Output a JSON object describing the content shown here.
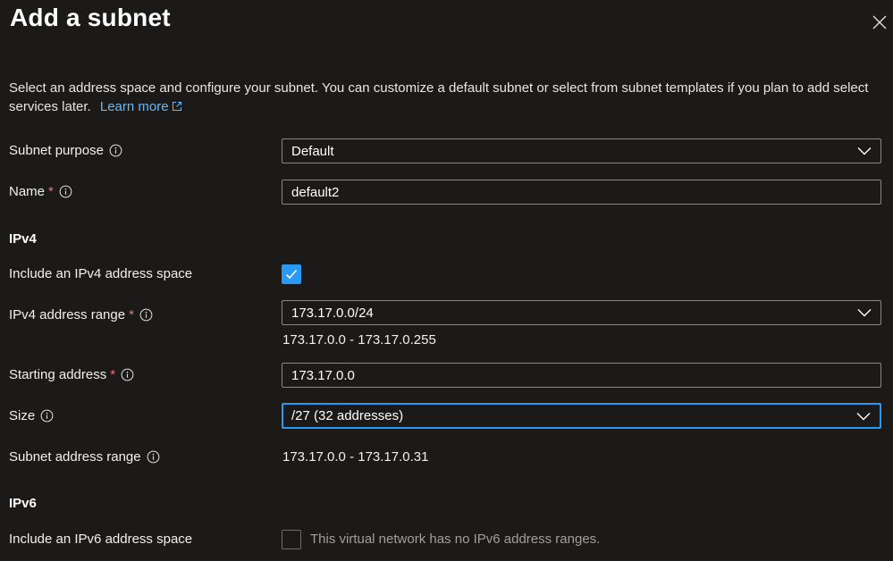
{
  "panel": {
    "title": "Add a subnet",
    "description": "Select an address space and configure your subnet. You can customize a default subnet or select from subnet templates if you plan to add select services later.",
    "learn_more": "Learn more"
  },
  "fields": {
    "subnet_purpose": {
      "label": "Subnet purpose",
      "value": "Default"
    },
    "name": {
      "label": "Name",
      "required": "*",
      "value": "default2"
    },
    "ipv4_section": "IPv4",
    "include_ipv4": {
      "label": "Include an IPv4 address space",
      "checked": true
    },
    "ipv4_range": {
      "label": "IPv4 address range",
      "required": "*",
      "value": "173.17.0.0/24",
      "hint": "173.17.0.0 - 173.17.0.255"
    },
    "starting_address": {
      "label": "Starting address",
      "required": "*",
      "value": "173.17.0.0"
    },
    "size": {
      "label": "Size",
      "value": "/27 (32 addresses)"
    },
    "subnet_range": {
      "label": "Subnet address range",
      "value": "173.17.0.0 - 173.17.0.31"
    },
    "ipv6_section": "IPv6",
    "include_ipv6": {
      "label": "Include an IPv6 address space",
      "checked": false,
      "note": "This virtual network has no IPv6 address ranges."
    }
  },
  "colors": {
    "background": "#1b1a19",
    "accent": "#2899f5",
    "link": "#6cb8f6",
    "required": "#f1707b",
    "border": "#8a8886"
  },
  "icons": [
    "close-icon",
    "external-link-icon",
    "info-icon",
    "chevron-down-icon",
    "checkmark-icon"
  ]
}
